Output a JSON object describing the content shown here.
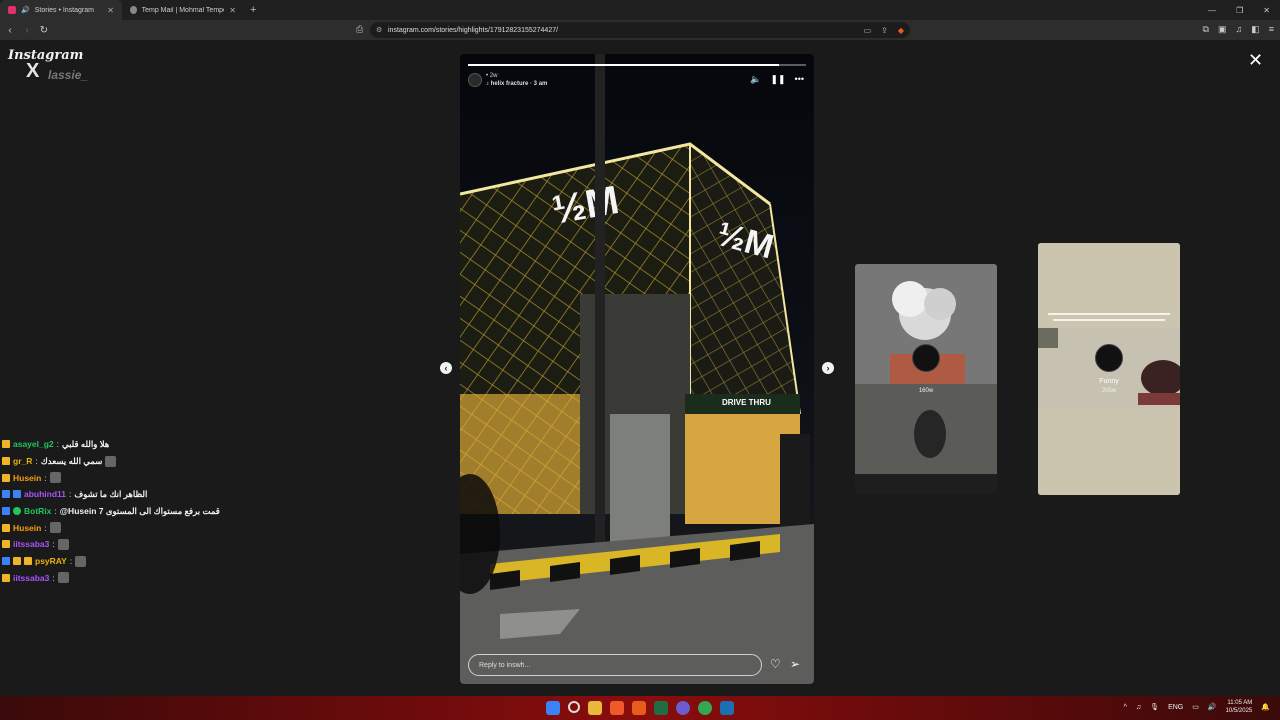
{
  "browser": {
    "tabs": [
      {
        "title": "Stories • Instagram",
        "active": true
      },
      {
        "title": "Temp Mail | Mohmal Temporary Disp",
        "active": false
      }
    ],
    "url": "instagram.com/stories/highlights/17912823155274427/"
  },
  "overlay": {
    "logo_text": "Instagram",
    "x_mark": "X",
    "handle": "lassie_"
  },
  "story": {
    "time_ago": "2w",
    "music": "helix fracture · 3 am",
    "progress": 0.92,
    "reply_placeholder": "Reply to inswh..."
  },
  "side_stories": [
    {
      "name": "",
      "time": "160w"
    },
    {
      "name": "Funny",
      "time": "205w"
    }
  ],
  "chat": [
    {
      "user": "asayel_g2",
      "color": "#22c55e",
      "badges": [
        "crown"
      ],
      "text": "هلا والله قلبي"
    },
    {
      "user": "gr_R",
      "color": "#eab308",
      "badges": [
        "crown"
      ],
      "text": "سمي الله يسعدك",
      "emote": true
    },
    {
      "user": "Husein",
      "color": "#f59e0b",
      "badges": [
        "crown"
      ],
      "text": "",
      "emote": true
    },
    {
      "user": "abuhind11",
      "color": "#a855f7",
      "badges": [
        "blue",
        "blue"
      ],
      "text": "الظاهر انك ما تشوف"
    },
    {
      "user": "BotRix",
      "color": "#22c55e",
      "badges": [
        "blue",
        "green"
      ],
      "text": "@Husein 7 قمت برفع مستواك الى المستوى"
    },
    {
      "user": "Husein",
      "color": "#f59e0b",
      "badges": [
        "crown"
      ],
      "text": "",
      "emote": true
    },
    {
      "user": "iitssaba3",
      "color": "#a855f7",
      "badges": [
        "crown"
      ],
      "text": "",
      "emote": true
    },
    {
      "user": "psyRAY",
      "color": "#eab308",
      "badges": [
        "blue",
        "crown",
        "crown"
      ],
      "text": "",
      "emote": true
    },
    {
      "user": "iitssaba3",
      "color": "#a855f7",
      "badges": [
        "crown"
      ],
      "text": "",
      "emote": true
    }
  ],
  "taskbar": {
    "lang": "ENG",
    "time": "11:05 AM",
    "date": "10/5/2025"
  }
}
